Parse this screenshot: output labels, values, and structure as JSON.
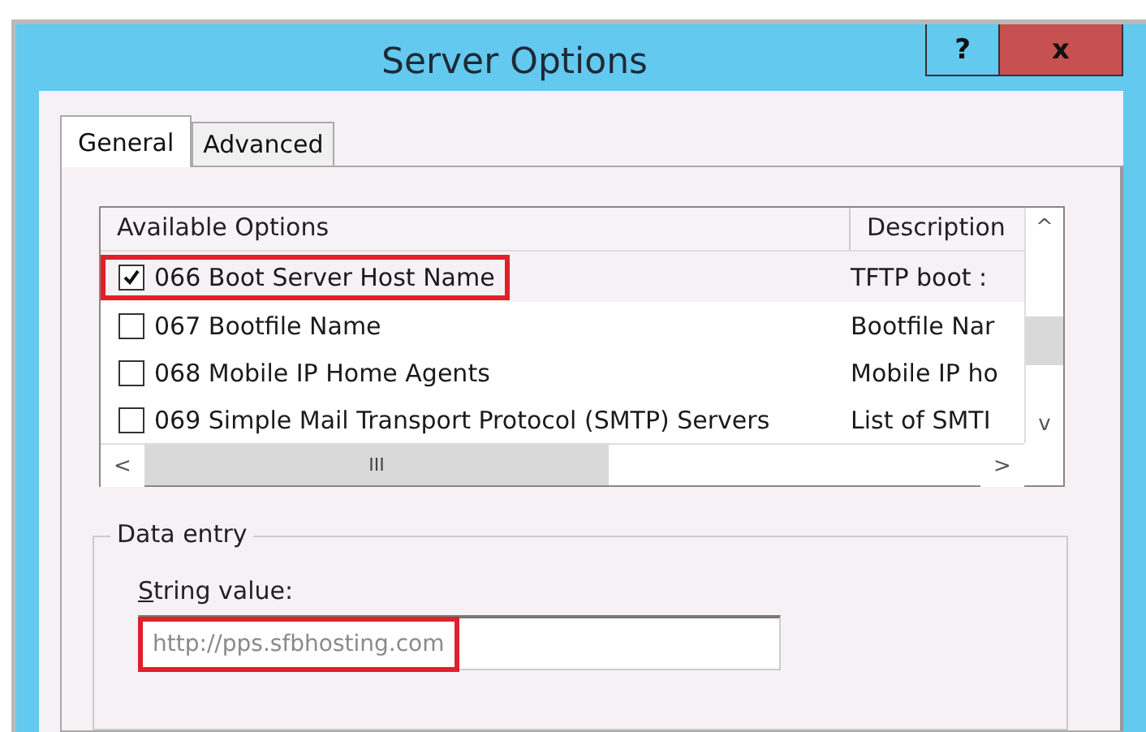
{
  "window": {
    "title": "Server Options",
    "buttons": [
      {
        "kind": "help",
        "label": "?"
      },
      {
        "kind": "close",
        "label": "x"
      }
    ]
  },
  "tabs": [
    {
      "label": "General",
      "selected": true
    },
    {
      "label": "Advanced",
      "selected": false
    }
  ],
  "options_list": {
    "columns": [
      "Available Options",
      "Description"
    ],
    "rows": [
      {
        "name": "066 Boot Server Host Name",
        "description": "TFTP boot :",
        "checked": true,
        "highlighted": true
      },
      {
        "name": "067 Bootfile Name",
        "description": "Bootfile Nar",
        "checked": false,
        "highlighted": false
      },
      {
        "name": "068 Mobile IP Home Agents",
        "description": "Mobile IP ho",
        "checked": false,
        "highlighted": false
      },
      {
        "name": "069 Simple Mail Transport Protocol (SMTP) Servers",
        "description": "List of SMTI",
        "checked": false,
        "highlighted": false
      }
    ],
    "scroll_labels": {
      "up": "^",
      "down": "v",
      "left": "<",
      "right": ">",
      "grip": "III"
    }
  },
  "data_entry": {
    "title": "Data entry",
    "label": "String value:",
    "value": "http://pps.sfbhosting.com",
    "highlighted": true
  }
}
